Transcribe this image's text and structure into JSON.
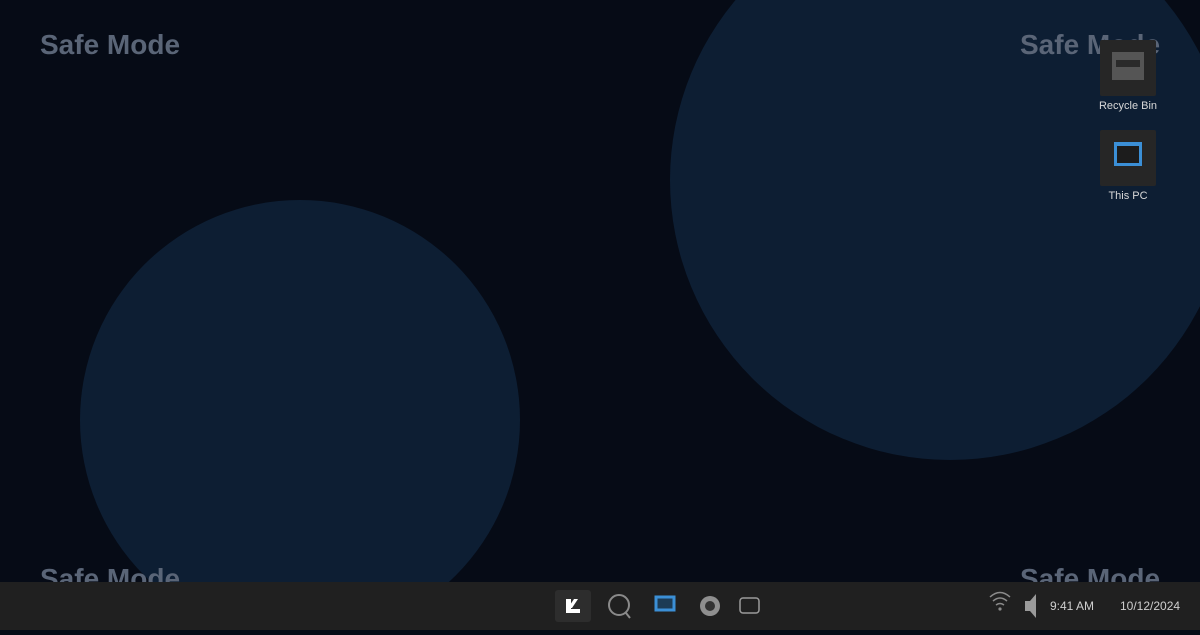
{
  "desktop": {
    "watermark_text": "Safe Mode",
    "background_color": "#060b16",
    "circle_color": "#0d1e33",
    "icons": [
      {
        "label": "Recycle Bin",
        "icon": "recycle-bin-icon"
      },
      {
        "label": "This PC",
        "icon": "this-pc-icon"
      }
    ]
  },
  "taskbar": {
    "background_color": "#202020",
    "apps": [
      {
        "name": "start",
        "icon": "start-icon"
      },
      {
        "name": "search",
        "icon": "search-icon"
      },
      {
        "name": "file-explorer",
        "icon": "file-explorer-icon"
      },
      {
        "name": "settings",
        "icon": "settings-icon"
      },
      {
        "name": "task-view",
        "icon": "task-view-icon"
      }
    ],
    "tray": {
      "wifi_icon": "wifi-icon",
      "volume_icon": "volume-icon",
      "time": "9:41 AM",
      "date": "10/12/2024"
    },
    "accent_color": "#3b8fd6"
  }
}
